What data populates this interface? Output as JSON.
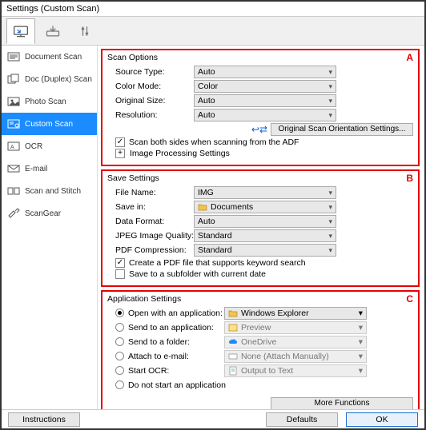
{
  "window": {
    "title": "Settings (Custom Scan)"
  },
  "sidebar": {
    "items": [
      {
        "label": "Document Scan"
      },
      {
        "label": "Doc (Duplex) Scan"
      },
      {
        "label": "Photo Scan"
      },
      {
        "label": "Custom Scan"
      },
      {
        "label": "OCR"
      },
      {
        "label": "E-mail"
      },
      {
        "label": "Scan and Stitch"
      },
      {
        "label": "ScanGear"
      }
    ]
  },
  "scanOptions": {
    "title": "Scan Options",
    "letter": "A",
    "sourceType": {
      "label": "Source Type:",
      "value": "Auto"
    },
    "colorMode": {
      "label": "Color Mode:",
      "value": "Color"
    },
    "originalSize": {
      "label": "Original Size:",
      "value": "Auto"
    },
    "resolution": {
      "label": "Resolution:",
      "value": "Auto"
    },
    "orientationBtn": "Original Scan Orientation Settings...",
    "scanBoth": {
      "label": "Scan both sides when scanning from the ADF",
      "checked": true
    },
    "imageProc": "Image Processing Settings"
  },
  "saveSettings": {
    "title": "Save Settings",
    "letter": "B",
    "fileName": {
      "label": "File Name:",
      "value": "IMG"
    },
    "saveIn": {
      "label": "Save in:",
      "value": "Documents"
    },
    "dataFormat": {
      "label": "Data Format:",
      "value": "Auto"
    },
    "jpegQuality": {
      "label": "JPEG Image Quality:",
      "value": "Standard"
    },
    "pdfCompression": {
      "label": "PDF Compression:",
      "value": "Standard"
    },
    "createPdf": {
      "label": "Create a PDF file that supports keyword search",
      "checked": true
    },
    "subfolder": {
      "label": "Save to a subfolder with current date",
      "checked": false
    }
  },
  "appSettings": {
    "title": "Application Settings",
    "letter": "C",
    "openWith": {
      "label": "Open with an application:",
      "value": "Windows Explorer"
    },
    "sendApp": {
      "label": "Send to an application:",
      "value": "Preview"
    },
    "sendFolder": {
      "label": "Send to a folder:",
      "value": "OneDrive"
    },
    "attachEmail": {
      "label": "Attach to e-mail:",
      "value": "None (Attach Manually)"
    },
    "startOcr": {
      "label": "Start OCR:",
      "value": "Output to Text"
    },
    "noStart": {
      "label": "Do not start an application"
    },
    "moreFunctions": "More Functions"
  },
  "footer": {
    "instructions": "Instructions",
    "defaults": "Defaults",
    "ok": "OK"
  }
}
